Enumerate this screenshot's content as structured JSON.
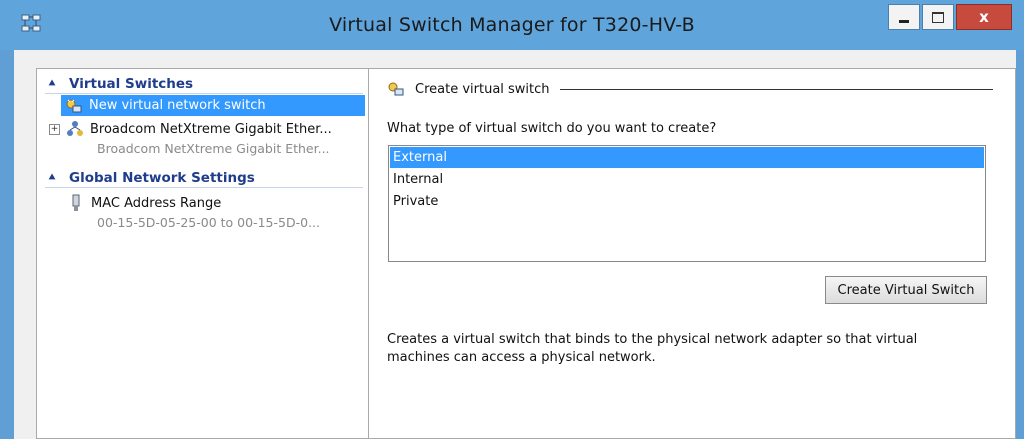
{
  "window": {
    "title": "Virtual Switch Manager for T320-HV-B",
    "icon": "virtual-switch-manager-icon",
    "controls": {
      "minimize": "minimize-icon",
      "maximize": "maximize-icon",
      "close_label": "x"
    }
  },
  "left_pane": {
    "virtual_switches": {
      "header": "Virtual Switches",
      "items": [
        {
          "label": "New virtual network switch",
          "icon": "new-switch-icon",
          "selected": true
        },
        {
          "label": "Broadcom NetXtreme Gigabit Ether...",
          "sublabel": "Broadcom NetXtreme Gigabit Ether...",
          "icon": "network-switch-icon",
          "expander": "+"
        }
      ]
    },
    "global_settings": {
      "header": "Global Network Settings",
      "items": [
        {
          "label": "MAC Address Range",
          "sublabel": "00-15-5D-05-25-00 to 00-15-5D-0...",
          "icon": "mac-address-icon"
        }
      ]
    }
  },
  "right_pane": {
    "group_title": "Create virtual switch",
    "question": "What type of virtual switch do you want to create?",
    "switch_types": [
      "External",
      "Internal",
      "Private"
    ],
    "selected_type": "External",
    "create_button": "Create Virtual Switch",
    "description": "Creates a virtual switch that binds to the physical network adapter so that virtual machines can access a physical network."
  },
  "colors": {
    "titlebar": "#60a4dc",
    "selection": "#3399ff",
    "header_text": "#1f3d8c",
    "close_button": "#c74a3f"
  }
}
